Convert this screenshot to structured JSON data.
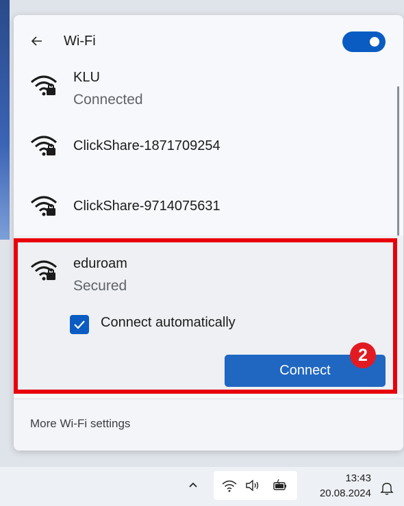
{
  "panel": {
    "title": "Wi-Fi",
    "wifi_enabled": true,
    "back_icon": "arrow-left-icon"
  },
  "networks": [
    {
      "name": "KLU",
      "status": "Connected",
      "icon": "wifi-secured-icon"
    },
    {
      "name": "ClickShare-1871709254",
      "status": "",
      "icon": "wifi-secured-icon"
    },
    {
      "name": "ClickShare-9714075631",
      "status": "",
      "icon": "wifi-secured-icon"
    },
    {
      "name": "eduroam",
      "status": "Secured",
      "icon": "wifi-secured-icon"
    }
  ],
  "expanded_network": {
    "connect_automatically_label": "Connect automatically",
    "connect_automatically_checked": true,
    "connect_button": "Connect"
  },
  "footer": {
    "link": "More Wi-Fi settings"
  },
  "annotation": {
    "step_number": "2",
    "highlight_color": "#e8000b"
  },
  "taskbar": {
    "time": "13:43",
    "date": "20.08.2024",
    "icons": [
      "chevron-up-icon",
      "wifi-icon",
      "speaker-icon",
      "battery-icon",
      "bell-icon"
    ]
  },
  "colors": {
    "accent": "#0a5cc2",
    "button": "#1f67c1"
  }
}
